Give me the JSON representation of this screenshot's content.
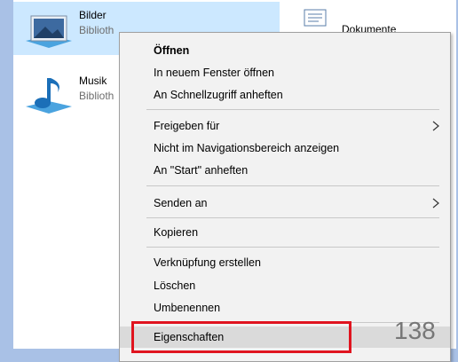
{
  "libraries": [
    {
      "title": "Bilder",
      "subtitle": "Biblioth",
      "icon": "pictures-library-icon"
    },
    {
      "title": "Musik",
      "subtitle": "Biblioth",
      "icon": "music-library-icon"
    },
    {
      "title": "Dokumente",
      "icon": "documents-library-icon"
    }
  ],
  "context_menu": {
    "items": [
      {
        "label": "Öffnen",
        "bold": true
      },
      {
        "label": "In neuem Fenster öffnen"
      },
      {
        "label": "An Schnellzugriff anheften"
      },
      {
        "label": "Freigeben für",
        "submenu": true
      },
      {
        "label": "Nicht im Navigationsbereich anzeigen"
      },
      {
        "label": "An \"Start\" anheften"
      },
      {
        "label": "Senden an",
        "submenu": true
      },
      {
        "label": "Kopieren"
      },
      {
        "label": "Verknüpfung erstellen"
      },
      {
        "label": "Löschen"
      },
      {
        "label": "Umbenennen"
      },
      {
        "label": "Eigenschaften",
        "highlighted": true
      }
    ]
  },
  "slide_page_number": "138",
  "colors": {
    "background": "#a9c1e6",
    "selection": "#cce8ff",
    "menu_bg": "#f2f2f2",
    "annotation_red": "#e0141f"
  }
}
